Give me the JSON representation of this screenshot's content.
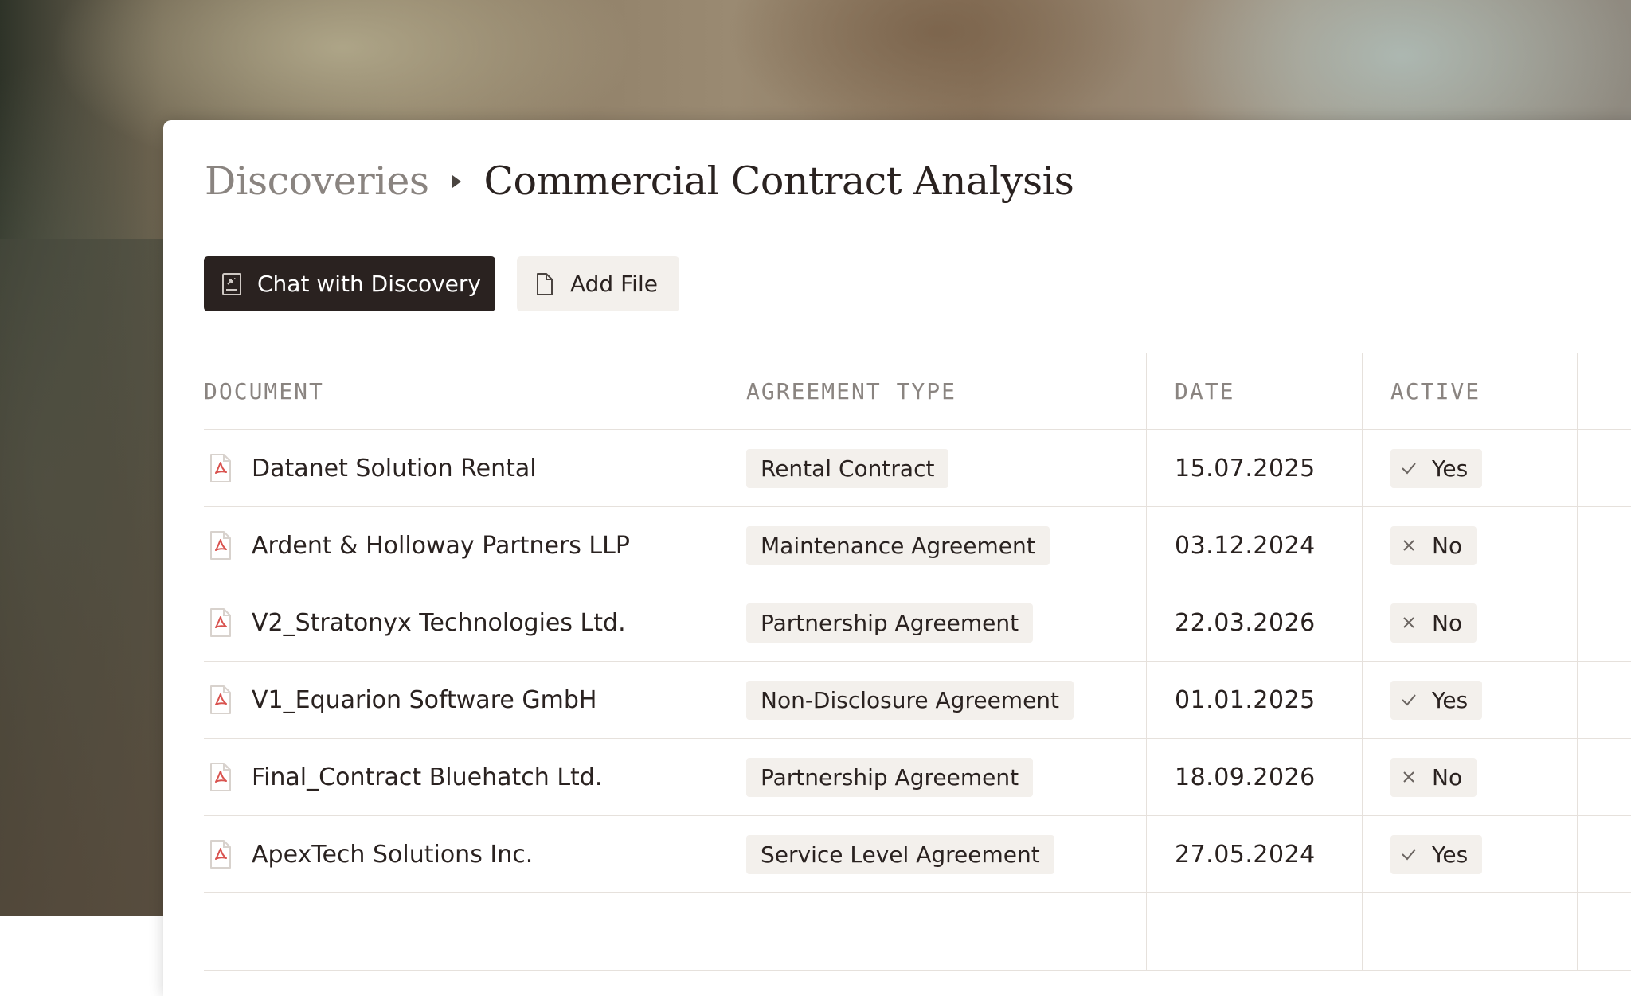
{
  "breadcrumb": {
    "parent": "Discoveries",
    "current": "Commercial Contract Analysis"
  },
  "actions": {
    "chat_label": "Chat with Discovery",
    "chat_icon": "chat-document-icon",
    "add_file_label": "Add File",
    "add_file_icon": "file-icon"
  },
  "table": {
    "headers": [
      "DOCUMENT",
      "AGREEMENT TYPE",
      "DATE",
      "ACTIVE"
    ],
    "rows": [
      {
        "document": "Datanet Solution Rental",
        "type": "Rental Contract",
        "date": "15.07.2025",
        "active": "Yes",
        "active_icon": "check-icon"
      },
      {
        "document": "Ardent & Holloway Partners LLP",
        "type": "Maintenance Agreement",
        "date": "03.12.2024",
        "active": "No",
        "active_icon": "x-icon"
      },
      {
        "document": "V2_Stratonyx Technologies Ltd.",
        "type": "Partnership Agreement",
        "date": "22.03.2026",
        "active": "No",
        "active_icon": "x-icon"
      },
      {
        "document": "V1_Equarion Software GmbH",
        "type": "Non-Disclosure Agreement",
        "date": "01.01.2025",
        "active": "Yes",
        "active_icon": "check-icon"
      },
      {
        "document": "Final_Contract Bluehatch Ltd.",
        "type": "Partnership Agreement",
        "date": "18.09.2026",
        "active": "No",
        "active_icon": "x-icon"
      },
      {
        "document": "ApexTech Solutions Inc.",
        "type": "Service Level Agreement",
        "date": "27.05.2024",
        "active": "Yes",
        "active_icon": "check-icon"
      }
    ]
  },
  "colors": {
    "primary_button": "#2a2220",
    "tag_background": "#f3f0ec",
    "pdf_icon": "#d9534f",
    "header_text": "#8a8480",
    "divider": "#e6e1dc"
  }
}
